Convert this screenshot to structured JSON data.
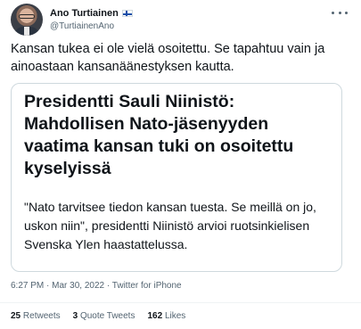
{
  "author": {
    "name": "Ano Turtiainen",
    "handle": "@TurtiainenAno",
    "flag": "finland-flag"
  },
  "tweet": {
    "text": "Kansan tukea ei ole vielä osoitettu. Se tapahtuu vain ja ainoastaan kansanäänestyksen kautta."
  },
  "card": {
    "title": "Presidentti Sauli Niinistö: Mahdollisen Nato-jäsenyyden vaatima kansan tuki on osoitettu kyselyissä",
    "body": "\"Nato tarvitsee tiedon kansan tuesta. Se meillä on jo, uskon niin\", presidentti Niinistö arvioi ruotsinkielisen Svenska Ylen haastattelussa."
  },
  "meta": {
    "time": "6:27 PM",
    "separator1": " · ",
    "date": "Mar 30, 2022",
    "separator2": " · ",
    "source": "Twitter for iPhone"
  },
  "stats": {
    "retweets_count": "25",
    "retweets_label": "Retweets",
    "quotes_count": "3",
    "quotes_label": "Quote Tweets",
    "likes_count": "162",
    "likes_label": "Likes"
  },
  "colors": {
    "text": "#0f1419",
    "secondary": "#536471",
    "border": "#cfd9de"
  }
}
